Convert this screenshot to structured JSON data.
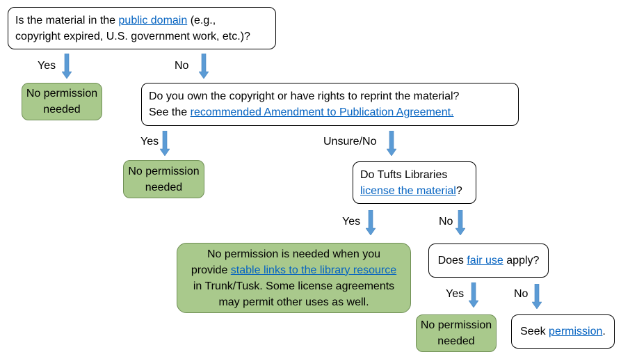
{
  "q1": {
    "pre": "Is the material in the ",
    "link": "public domain",
    "post": " (e.g.,",
    "line2": "copyright expired, U.S. government work, etc.)?"
  },
  "q2": {
    "line1": "Do you own the copyright or have rights to reprint the material?",
    "pre": "See the ",
    "link": "recommended Amendment to Publication Agreement."
  },
  "q3": {
    "line1": "Do Tufts Libraries",
    "link": "license the material",
    "post": "?"
  },
  "q4": {
    "pre": "Does ",
    "link": "fair use",
    "post": " apply?"
  },
  "seek": {
    "pre": "Seek ",
    "link": "permission",
    "post": "."
  },
  "no_permission": {
    "line1": "No permission",
    "line2": "needed"
  },
  "license_result": {
    "line1": "No permission is needed when you",
    "pre": "provide ",
    "link": "stable links to the library resource",
    "line3": "in Trunk/Tusk.  Some license agreements",
    "line4": "may permit other uses as well."
  },
  "labels": {
    "yes": "Yes",
    "no": "No",
    "unsure_no": "Unsure/No"
  },
  "colors": {
    "green_fill": "#a9c98c",
    "arrow": "#5b9bd5",
    "link": "#0563c1"
  }
}
